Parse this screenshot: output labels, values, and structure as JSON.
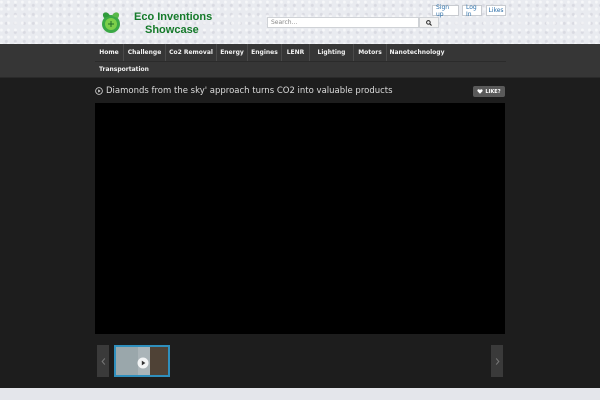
{
  "header": {
    "logo": {
      "line1": "Eco Inventions",
      "line2": "Showcase"
    },
    "search": {
      "placeholder": "Search..."
    },
    "auth": {
      "signup": "Sign up",
      "login": "Log In",
      "likes": "Likes"
    }
  },
  "nav": {
    "items": [
      "Home",
      "Challenge",
      "Co2 Removal",
      "Energy",
      "Engines",
      "LENR",
      "Lighting",
      "Motors",
      "Nanotechnology",
      "Transportation"
    ]
  },
  "video": {
    "title": "Diamonds from the sky' approach turns CO2 into valuable products",
    "like_label": "LIKE?"
  },
  "colors": {
    "brand_green": "#157a2a",
    "nav_bg": "#363636",
    "page_bg": "#1d1d1d",
    "thumb_border": "#2f8fbd"
  }
}
